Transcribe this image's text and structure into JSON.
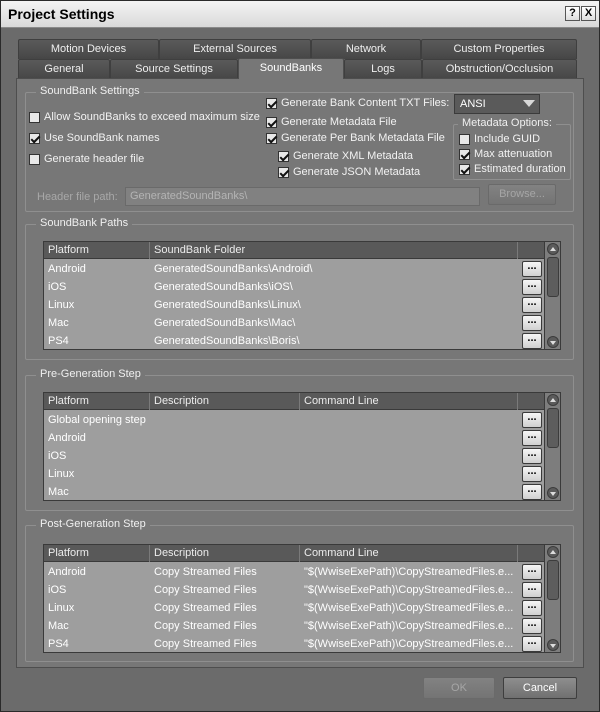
{
  "window": {
    "title": "Project Settings",
    "help_label": "?",
    "close_label": "X"
  },
  "tabs": {
    "row1": [
      {
        "label": "Motion Devices"
      },
      {
        "label": "External Sources"
      },
      {
        "label": "Network"
      },
      {
        "label": "Custom Properties"
      }
    ],
    "row2": [
      {
        "label": "General"
      },
      {
        "label": "Source Settings"
      },
      {
        "label": "SoundBanks",
        "active": true
      },
      {
        "label": "Logs"
      },
      {
        "label": "Obstruction/Occlusion"
      }
    ]
  },
  "soundbank_settings": {
    "label": "SoundBank Settings",
    "allow_exceed": {
      "label": "Allow SoundBanks to exceed maximum size",
      "checked": false
    },
    "use_names": {
      "label": "Use SoundBank names",
      "checked": true
    },
    "gen_header": {
      "label": "Generate header file",
      "checked": false
    },
    "gen_txt": {
      "label": "Generate Bank Content TXT Files:",
      "checked": true
    },
    "encoding": {
      "value": "ANSI"
    },
    "gen_metadata": {
      "label": "Generate Metadata File",
      "checked": true
    },
    "gen_per_bank": {
      "label": "Generate Per Bank Metadata File",
      "checked": true
    },
    "gen_xml": {
      "label": "Generate XML Metadata",
      "checked": true
    },
    "gen_json": {
      "label": "Generate JSON Metadata",
      "checked": true
    },
    "metadata_options": {
      "label": "Metadata Options:",
      "include_guid": {
        "label": "Include GUID",
        "checked": false
      },
      "max_atten": {
        "label": "Max attenuation",
        "checked": true
      },
      "est_duration": {
        "label": "Estimated duration",
        "checked": true
      }
    },
    "header_path": {
      "label": "Header file path:",
      "value": "GeneratedSoundBanks\\",
      "browse_label": "Browse..."
    }
  },
  "soundbank_paths": {
    "label": "SoundBank Paths",
    "columns": [
      "Platform",
      "SoundBank Folder"
    ],
    "rows": [
      {
        "platform": "Android",
        "folder": "GeneratedSoundBanks\\Android\\"
      },
      {
        "platform": "iOS",
        "folder": "GeneratedSoundBanks\\iOS\\"
      },
      {
        "platform": "Linux",
        "folder": "GeneratedSoundBanks\\Linux\\"
      },
      {
        "platform": "Mac",
        "folder": "GeneratedSoundBanks\\Mac\\"
      },
      {
        "platform": "PS4",
        "folder": "GeneratedSoundBanks\\Boris\\"
      }
    ]
  },
  "pre_generation": {
    "label": "Pre-Generation Step",
    "columns": [
      "Platform",
      "Description",
      "Command Line"
    ],
    "rows": [
      {
        "platform": "Global opening step",
        "description": "",
        "command": ""
      },
      {
        "platform": "Android",
        "description": "",
        "command": ""
      },
      {
        "platform": "iOS",
        "description": "",
        "command": ""
      },
      {
        "platform": "Linux",
        "description": "",
        "command": ""
      },
      {
        "platform": "Mac",
        "description": "",
        "command": ""
      }
    ]
  },
  "post_generation": {
    "label": "Post-Generation Step",
    "columns": [
      "Platform",
      "Description",
      "Command Line"
    ],
    "rows": [
      {
        "platform": "Android",
        "description": "Copy Streamed Files",
        "command": "\"$(WwiseExePath)\\CopyStreamedFiles.e..."
      },
      {
        "platform": "iOS",
        "description": "Copy Streamed Files",
        "command": "\"$(WwiseExePath)\\CopyStreamedFiles.e..."
      },
      {
        "platform": "Linux",
        "description": "Copy Streamed Files",
        "command": "\"$(WwiseExePath)\\CopyStreamedFiles.e..."
      },
      {
        "platform": "Mac",
        "description": "Copy Streamed Files",
        "command": "\"$(WwiseExePath)\\CopyStreamedFiles.e..."
      },
      {
        "platform": "PS4",
        "description": "Copy Streamed Files",
        "command": "\"$(WwiseExePath)\\CopyStreamedFiles.e..."
      }
    ]
  },
  "row_button_label": "...",
  "footer": {
    "ok_label": "OK",
    "cancel_label": "Cancel"
  }
}
